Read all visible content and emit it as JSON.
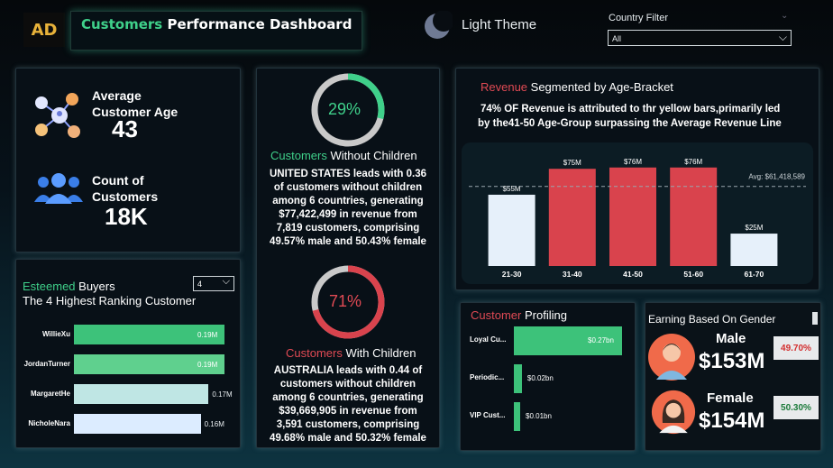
{
  "header": {
    "logo_text": "AD",
    "title_accent": "Customers",
    "title_rest": " Performance Dashboard",
    "theme_label": "Light Theme",
    "filter_label": "Country Filter",
    "filter_value": "All"
  },
  "kpis": {
    "avg_age_label_1": "Average",
    "avg_age_label_2": "Customer Age",
    "avg_age_value": "43",
    "count_label_1": "Count of",
    "count_label_2": "Customers",
    "count_value": "18K"
  },
  "without_children": {
    "percent": "29%",
    "fraction": 0.29,
    "title_accent": "Customers",
    "title_rest": " Without Children",
    "lines": [
      "UNITED STATES leads with 0.36",
      "of customers without children",
      "among 6 countries, generating",
      "$77,422,499 in revenue from",
      "7,819 customers, comprising",
      "49.57% male and 50.43% female"
    ]
  },
  "with_children": {
    "percent": "71%",
    "fraction": 0.71,
    "title_accent": "Customers",
    "title_rest": " With Children",
    "lines": [
      "AUSTRALIA leads with 0.44 of",
      "customers without children",
      "among 6 countries, generating",
      "$39,669,905 in revenue from",
      "3,591 customers, comprising",
      "49.68% male and 50.32% female"
    ]
  },
  "revenue_chart": {
    "title_accent": "Revenue",
    "title_rest": " Segmented by Age-Bracket",
    "note_line_1": "74% OF Revenue is attributed to thr yellow bars,primarily led",
    "note_line_2": "by the41-50 Age-Group surpassing the Average Revenue Line",
    "avg_label": "Avg: $61,418,589"
  },
  "chart_data": {
    "type": "bar",
    "categories": [
      "21-30",
      "31-40",
      "41-50",
      "51-60",
      "61-70"
    ],
    "values": [
      55,
      75,
      76,
      76,
      25
    ],
    "data_labels": [
      "$55M",
      "$75M",
      "$76M",
      "$76M",
      "$25M"
    ],
    "highlight": [
      false,
      true,
      true,
      true,
      false
    ],
    "average": 61.418589,
    "ylim": [
      0,
      80
    ],
    "title": "Revenue Segmented by Age-Bracket",
    "colors": {
      "normal": "#e6f0fa",
      "highlight": "#d9434d"
    }
  },
  "esteemed_buyers": {
    "title_accent": "Esteemed",
    "title_rest": " Buyers",
    "subtitle": "The 4 Highest Ranking Customer",
    "dropdown_value": "4",
    "rows": [
      {
        "name": "WillieXu",
        "value": "0.19M",
        "amount": 0.19,
        "color": "#3dc27a"
      },
      {
        "name": "JordanTurner",
        "value": "0.19M",
        "amount": 0.19,
        "color": "#5fd08e"
      },
      {
        "name": "MargaretHe",
        "value": "0.17M",
        "amount": 0.17,
        "color": "#bfe6e4"
      },
      {
        "name": "NicholeNara",
        "value": "0.16M",
        "amount": 0.16,
        "color": "#dcecff"
      }
    ]
  },
  "customer_profiling": {
    "title_accent": "Customer",
    "title_rest": " Profiling",
    "rows": [
      {
        "name": "Loyal Cu...",
        "value": "$0.27bn",
        "amount": 0.27
      },
      {
        "name": "Periodic...",
        "value": "$0.02bn",
        "amount": 0.02
      },
      {
        "name": "VIP Cust...",
        "value": "$0.01bn",
        "amount": 0.01
      }
    ]
  },
  "gender": {
    "title": "Earning Based On Gender",
    "male_label": "Male",
    "male_value": "$153M",
    "male_pct": "49.70%",
    "female_label": "Female",
    "female_value": "$154M",
    "female_pct": "50.30%"
  }
}
